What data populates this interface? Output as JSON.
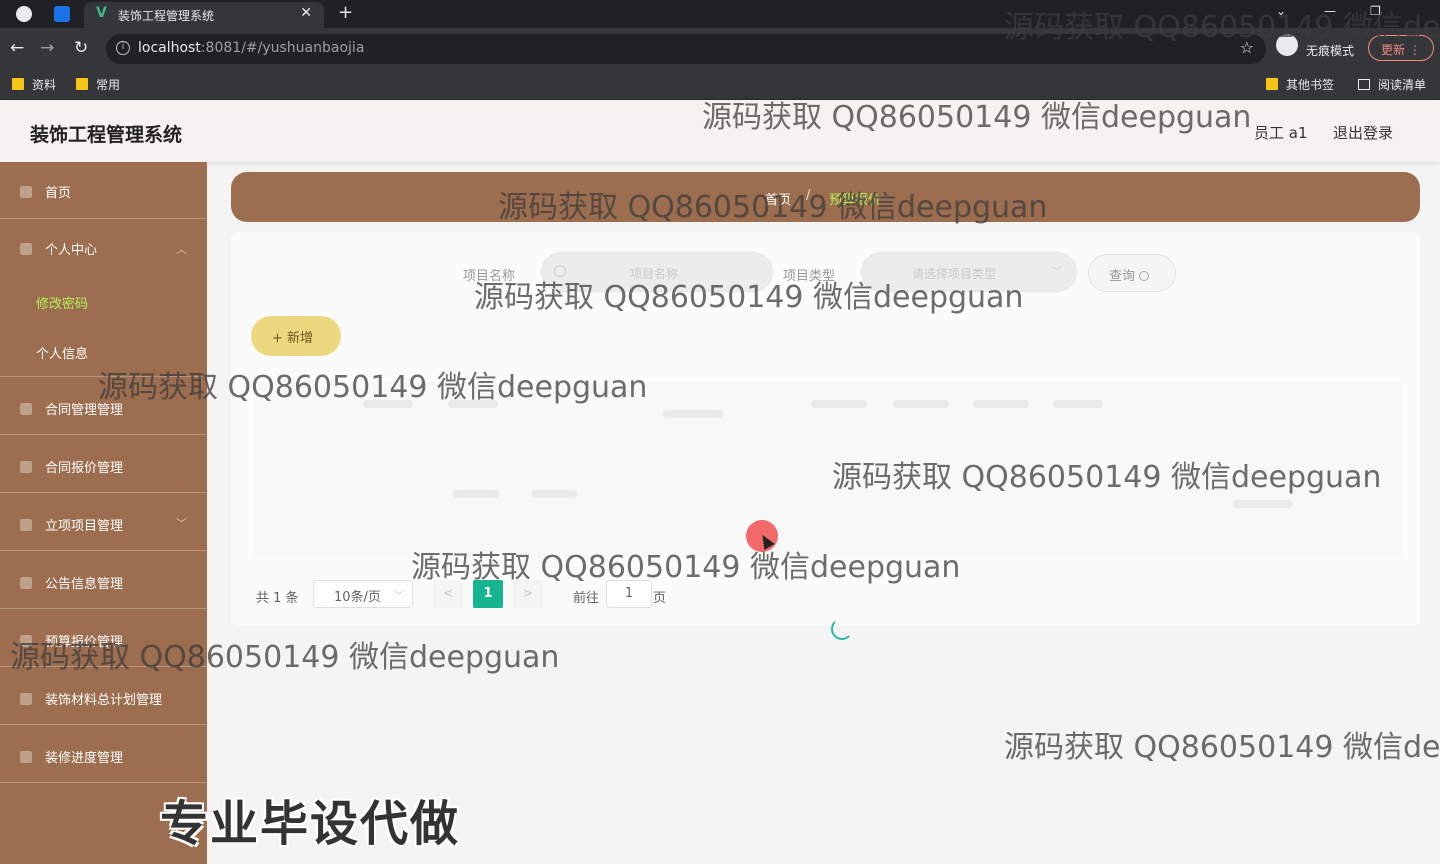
{
  "browser": {
    "tab_title": "装饰工程管理系统",
    "url_host": "localhost",
    "url_rest": ":8081/#/yushuanbaojia",
    "incognito_label": "无痕模式",
    "update_label": "更新",
    "bookmarks": [
      "资料",
      "常用"
    ],
    "other_bookmarks": "其他书签",
    "reading_list": "阅读清单"
  },
  "header": {
    "title": "装饰工程管理系统",
    "user": "员工 a1",
    "logout": "退出登录"
  },
  "sidebar": {
    "items": [
      {
        "label": "首页"
      },
      {
        "label": "个人中心"
      },
      {
        "label": "修改密码"
      },
      {
        "label": "个人信息"
      },
      {
        "label": "合同管理管理"
      },
      {
        "label": "合同报价管理"
      },
      {
        "label": "立项项目管理"
      },
      {
        "label": "公告信息管理"
      },
      {
        "label": "预算报价管理"
      },
      {
        "label": "装饰材料总计划管理"
      },
      {
        "label": "装修进度管理"
      }
    ]
  },
  "breadcrumb": {
    "home": "首页",
    "separator": "/",
    "current": "预算报价"
  },
  "search": {
    "name_label": "项目名称",
    "name_placeholder": "项目名称",
    "type_label": "项目类型",
    "type_placeholder": "请选择项目类型",
    "query_label": "查询"
  },
  "actions": {
    "add_label": "+ 新增"
  },
  "pagination": {
    "total": "共 1 条",
    "page_size": "10条/页",
    "prev": "<",
    "current_page": "1",
    "next": ">",
    "goto_label": "前往",
    "goto_value": "1",
    "page_unit": "页"
  },
  "watermarks": [
    "源码获取 QQ86050149 微信dee",
    "源码获取 QQ86050149 微信deepguan",
    "源码获取 QQ86050149 微信deepguan",
    "源码获取 QQ86050149 微信deepguan",
    "源码获取 QQ86050149 微信deepguan",
    "源码获取 QQ86050149 微信deepguan",
    "源码获取 QQ86050149 微信deepguan",
    "源码获取 QQ86050149 微信deepguan",
    "源码获取 QQ86050149 微信dee"
  ],
  "overlay": "专业毕设代做",
  "colors": {
    "sidebar": "#9c6d4e",
    "active_submenu": "#b6f05a",
    "page_active": "#16b48f",
    "add_button": "#ecd87e"
  }
}
